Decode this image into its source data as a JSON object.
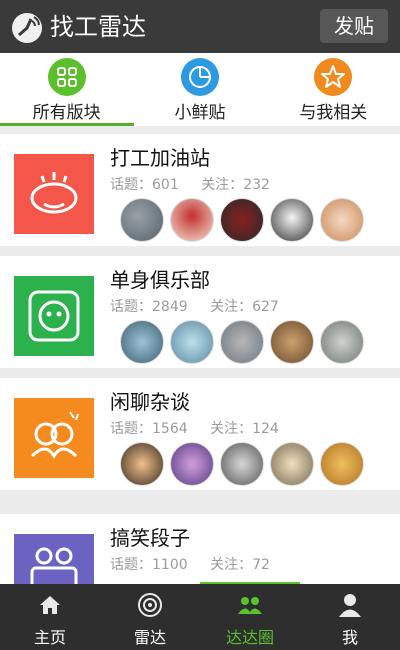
{
  "header": {
    "title": "找工雷达",
    "post_label": "发贴"
  },
  "tabs": [
    {
      "label": "所有版块",
      "icon": "grid-icon",
      "color": "#5bbf2b",
      "active": true
    },
    {
      "label": "小鲜贴",
      "icon": "clock-chart-icon",
      "color": "#2b9ae0",
      "active": false
    },
    {
      "label": "与我相关",
      "icon": "star-icon",
      "color": "#f08a1e",
      "active": false
    }
  ],
  "forums": [
    {
      "name": "打工加油站",
      "topics_label": "话题：",
      "topics": "601",
      "follows_label": "关注：",
      "follows": "232",
      "color": "#f4564a",
      "icon": "face-icon"
    },
    {
      "name": "单身俱乐部",
      "topics_label": "话题：",
      "topics": "2849",
      "follows_label": "关注：",
      "follows": "627",
      "color": "#2bb24c",
      "icon": "chat-smile-icon"
    },
    {
      "name": "闲聊杂谈",
      "topics_label": "话题：",
      "topics": "1564",
      "follows_label": "关注：",
      "follows": "124",
      "color": "#f58a1f",
      "icon": "people-chat-icon"
    },
    {
      "name": "搞笑段子",
      "topics_label": "话题：",
      "topics": "1100",
      "follows_label": "关注：",
      "follows": "72",
      "color": "#6a63c2",
      "icon": "camera-icon"
    }
  ],
  "nav": [
    {
      "label": "主页",
      "icon": "home-icon",
      "active": false
    },
    {
      "label": "雷达",
      "icon": "radar-icon",
      "active": false
    },
    {
      "label": "达达圈",
      "icon": "group-icon",
      "active": true
    },
    {
      "label": "我",
      "icon": "user-icon",
      "active": false
    }
  ]
}
